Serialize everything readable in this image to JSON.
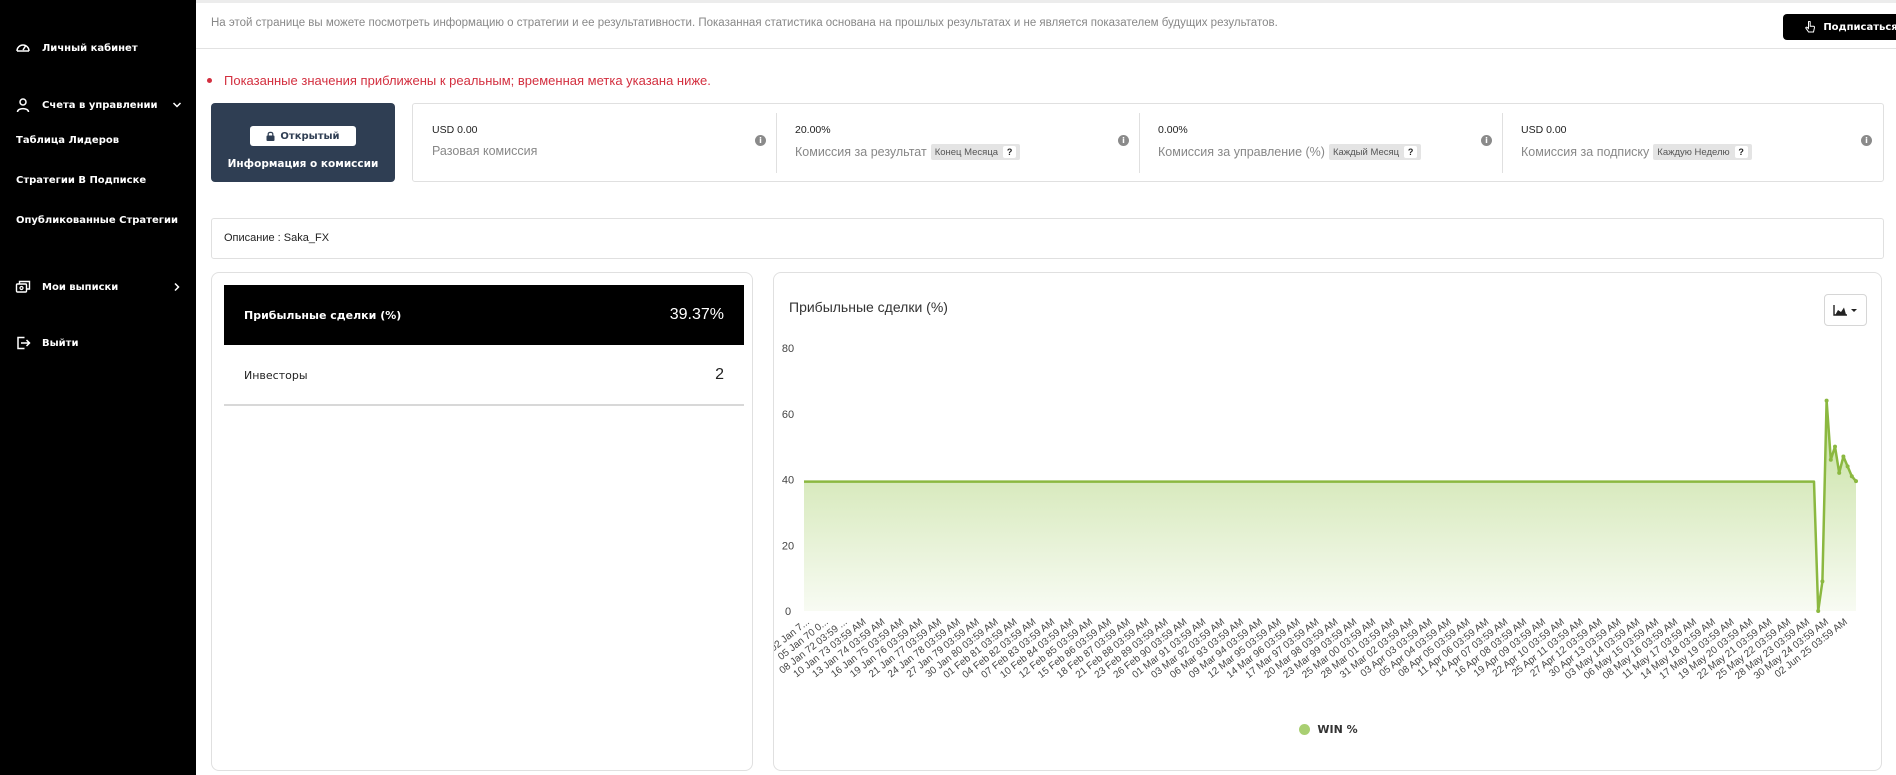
{
  "sidebar": {
    "items": [
      {
        "label": "Личный кабинет",
        "icon": "dashboard-icon"
      },
      {
        "label": "Счета в управлении",
        "icon": "user-icon"
      },
      {
        "label": "Таблица Лидеров"
      },
      {
        "label": "Стратегии В Подписке"
      },
      {
        "label": "Опубликованные Стратегии"
      },
      {
        "label": "Мои выписки",
        "icon": "statements-icon"
      },
      {
        "label": "Выйти",
        "icon": "logout-icon"
      }
    ]
  },
  "topbar": {
    "info": "На этой странице вы можете посмотреть информацию о стратегии и ее результативности. Показанная статистика основана на прошлых результатах и не является показателем будущих результатов.",
    "subscribe_label": "Подписаться"
  },
  "notice": "Показанные значения приближены к реальным; временная метка указана ниже.",
  "commission": {
    "open_label": "Открытый",
    "title": "Информация о комиссии"
  },
  "fees": [
    {
      "value": "USD 0.00",
      "label": "Разовая комиссия",
      "badge": ""
    },
    {
      "value": "20.00%",
      "label": "Комиссия за результат",
      "badge": "Конец Месяца"
    },
    {
      "value": "0.00%",
      "label": "Комиссия за управление (%)",
      "badge": "Каждый Месяц"
    },
    {
      "value": "USD 0.00",
      "label": "Комиссия за подписку",
      "badge": "Каждую Неделю"
    }
  ],
  "fee_badge_q": "?",
  "fee_info": "i",
  "description": "Описание : Saka_FX",
  "stats": [
    {
      "name": "Прибыльные сделки (%)",
      "value": "39.37%"
    },
    {
      "name": "Инвесторы",
      "value": "2"
    }
  ],
  "colors": {
    "accent": "#2f3e53",
    "alert": "#d32f3f",
    "series": "#8bb840",
    "fill": "#c4df9c"
  },
  "chart_data": {
    "type": "area",
    "title": "Прибыльные сделки (%)",
    "ylim": [
      0,
      80
    ],
    "yticks": [
      0,
      20,
      40,
      60,
      80
    ],
    "x": [
      "02 Jan 7...",
      "05 Jan 70 0...",
      "08 Jan 72 03:59 ...",
      "10 Jan 73 03:59 AM",
      "13 Jan 74 03:59 AM",
      "16 Jan 75 03:59 AM",
      "19 Jan 76 03:59 AM",
      "21 Jan 77 03:59 AM",
      "24 Jan 78 03:59 AM",
      "27 Jan 79 03:59 AM",
      "30 Jan 80 03:59 AM",
      "01 Feb 81 03:59 AM",
      "04 Feb 82 03:59 AM",
      "07 Feb 83 03:59 AM",
      "10 Feb 84 03:59 AM",
      "12 Feb 85 03:59 AM",
      "15 Feb 86 03:59 AM",
      "18 Feb 87 03:59 AM",
      "21 Feb 88 03:59 AM",
      "23 Feb 89 03:59 AM",
      "26 Feb 90 03:59 AM",
      "01 Mar 91 03:59 AM",
      "03 Mar 92 03:59 AM",
      "06 Mar 93 03:59 AM",
      "09 Mar 94 03:59 AM",
      "12 Mar 95 03:59 AM",
      "14 Mar 96 03:59 AM",
      "17 Mar 97 03:59 AM",
      "20 Mar 98 03:59 AM",
      "23 Mar 99 03:59 AM",
      "25 Mar 00 03:59 AM",
      "28 Mar 01 03:59 AM",
      "31 Mar 02 03:59 AM",
      "03 Apr 03 03:59 AM",
      "05 Apr 04 03:59 AM",
      "08 Apr 05 03:59 AM",
      "11 Apr 06 03:59 AM",
      "14 Apr 07 03:59 AM",
      "16 Apr 08 03:59 AM",
      "19 Apr 09 03:59 AM",
      "22 Apr 10 03:59 AM",
      "25 Apr 11 03:59 AM",
      "27 Apr 12 03:59 AM",
      "30 Apr 13 03:59 AM",
      "03 May 14 03:59 AM",
      "06 May 15 03:59 AM",
      "08 May 16 03:59 AM",
      "11 May 17 03:59 AM",
      "14 May 18 03:59 AM",
      "17 May 19 03:59 AM",
      "19 May 20 03:59 AM",
      "22 May 21 03:59 AM",
      "25 May 22 03:59 AM",
      "28 May 23 03:59 AM",
      "30 May 24 03:59 AM",
      "02 Jun 25 03:59 AM"
    ],
    "series": [
      {
        "name": "WIN %",
        "flat_value": 39.37,
        "tail_values": [
          39.37,
          0,
          9,
          64,
          46,
          50,
          42,
          47,
          44,
          41,
          39.5
        ]
      }
    ],
    "legend_position": "bottom"
  }
}
